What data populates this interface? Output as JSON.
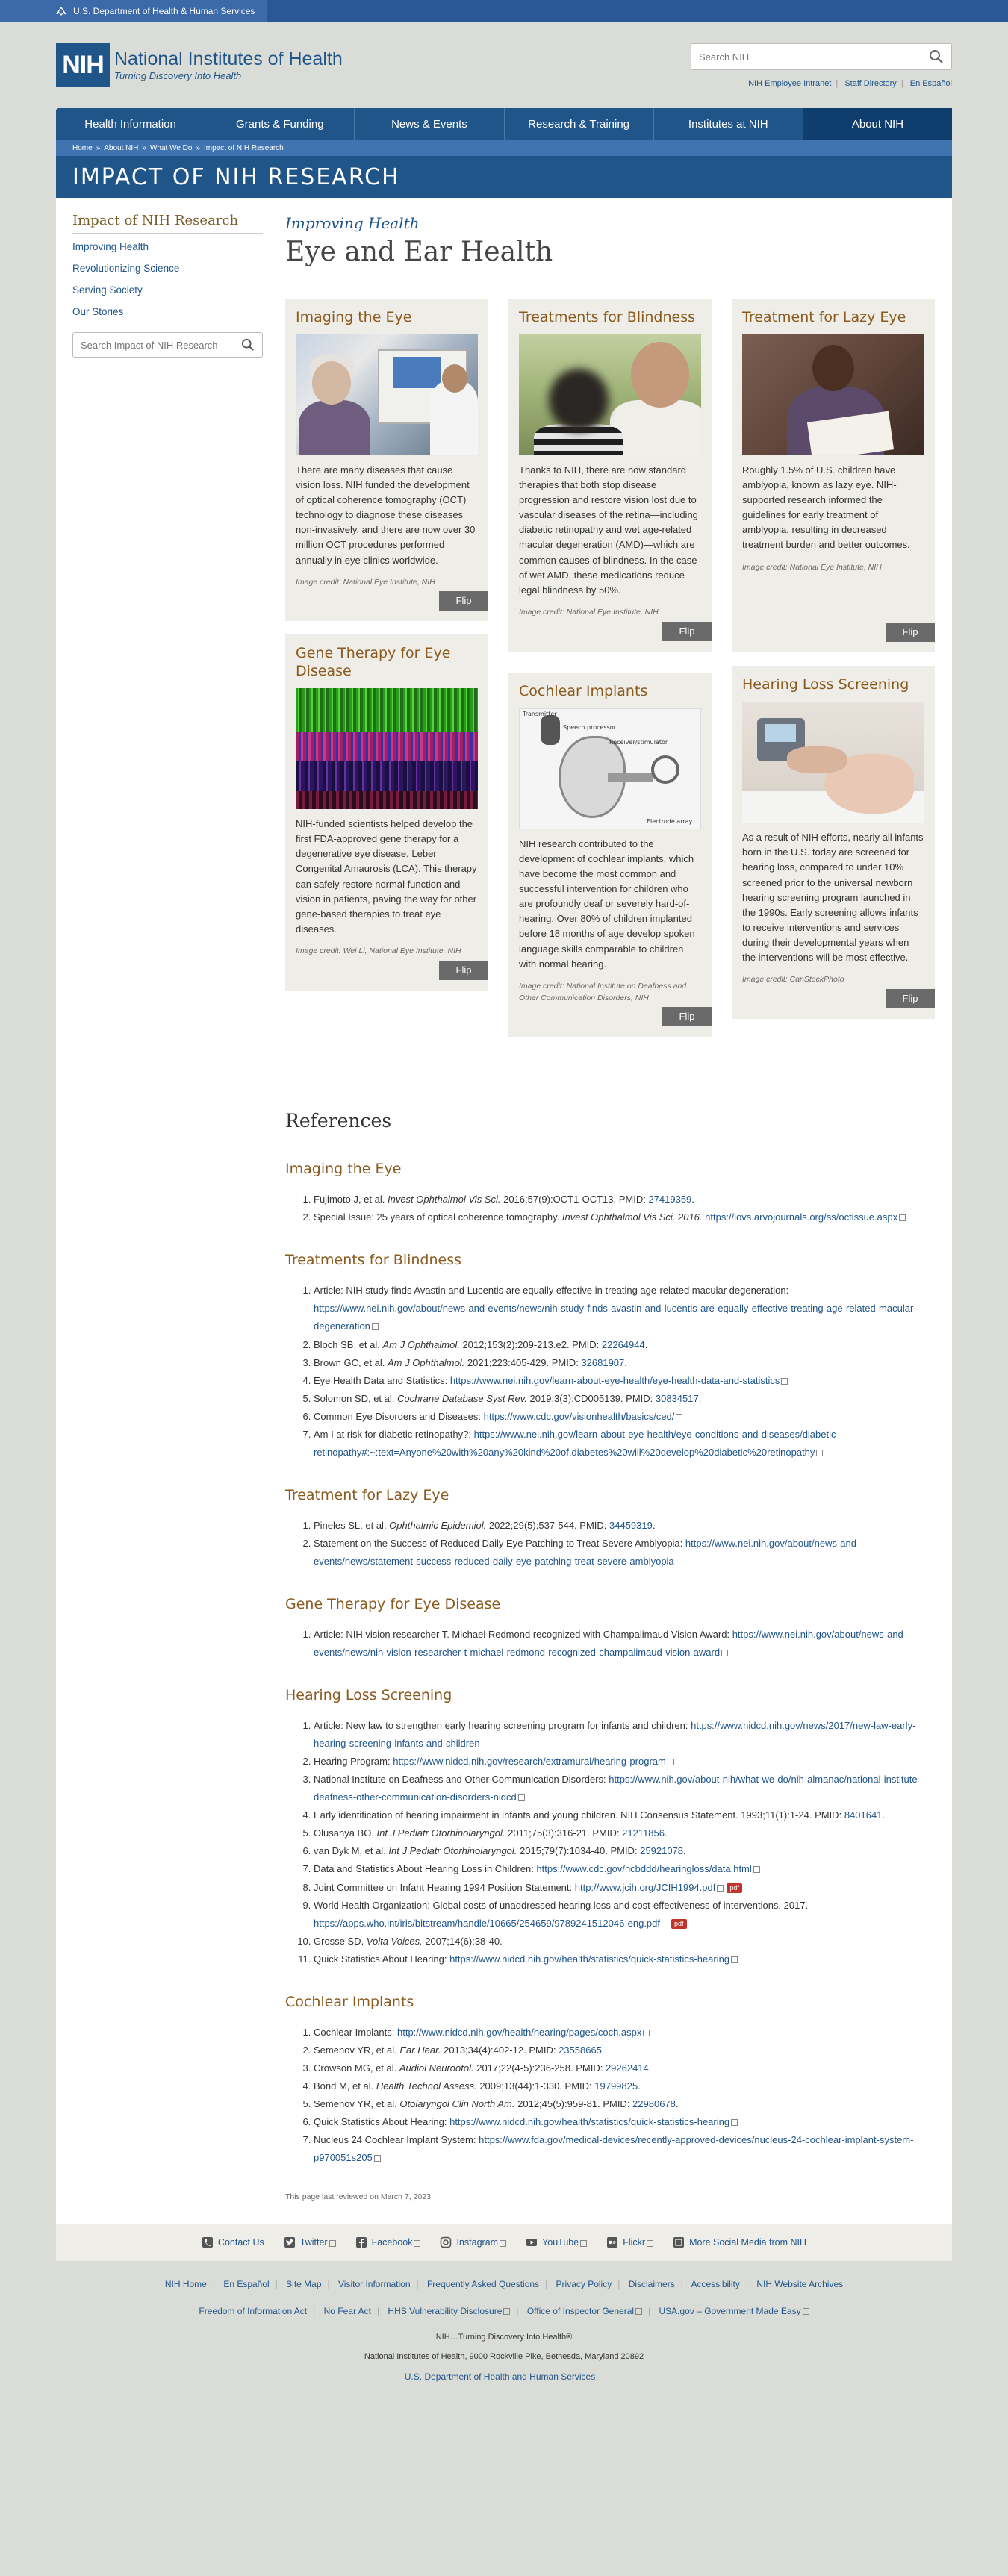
{
  "hhs": {
    "label": "U.S. Department of Health & Human Services"
  },
  "logo": {
    "mark": "NIH",
    "title": "National Institutes of Health",
    "tagline": "Turning Discovery Into Health"
  },
  "search": {
    "placeholder": "Search NIH"
  },
  "util_links": [
    "NIH Employee Intranet",
    "Staff Directory",
    "En Español"
  ],
  "nav": [
    "Health Information",
    "Grants & Funding",
    "News & Events",
    "Research & Training",
    "Institutes at NIH",
    "About NIH"
  ],
  "breadcrumb": [
    "Home",
    "About NIH",
    "What We Do",
    "Impact of NIH Research"
  ],
  "banner_title": "IMPACT OF NIH RESEARCH",
  "sidebar": {
    "title": "Impact of NIH Research",
    "links": [
      "Improving Health",
      "Revolutionizing Science",
      "Serving Society",
      "Our Stories"
    ],
    "search_placeholder": "Search Impact of NIH Research"
  },
  "page": {
    "kicker": "Improving Health",
    "title": "Eye and Ear Health"
  },
  "flip_label": "Flip",
  "cards": {
    "imaging": {
      "title": "Imaging the Eye",
      "body": "There are many diseases that cause vision loss. NIH funded the development of optical coherence tomography (OCT) technology to diagnose these diseases non-invasively, and there are now over 30 million OCT procedures performed annually in eye clinics worldwide.",
      "credit": "Image credit: National Eye Institute, NIH"
    },
    "blindness": {
      "title": "Treatments for Blindness",
      "body": "Thanks to NIH, there are now standard therapies that both stop disease progression and restore vision lost due to vascular diseases of the retina—including diabetic retinopathy and wet age-related macular degeneration (AMD)—which are common causes of blindness. In the case of wet AMD, these medications reduce legal blindness by 50%.",
      "credit": "Image credit: National Eye Institute, NIH"
    },
    "lazy": {
      "title": "Treatment for Lazy Eye",
      "body": "Roughly 1.5% of U.S. children have amblyopia, known as lazy eye. NIH-supported research informed the guidelines for early treatment of amblyopia, resulting in decreased treatment burden and better outcomes.",
      "credit": "Image credit: National Eye Institute, NIH"
    },
    "gene": {
      "title": "Gene Therapy for Eye Disease",
      "body": "NIH-funded scientists helped develop the first FDA-approved gene therapy for a degenerative eye disease, Leber Congenital Amaurosis (LCA). This therapy can safely restore normal function and vision in patients, paving the way for other gene-based therapies to treat eye diseases.",
      "credit": "Image credit: Wei Li, National Eye Institute, NIH"
    },
    "cochlear": {
      "title": "Cochlear Implants",
      "body": "NIH research contributed to the development of cochlear implants, which have become the most common and successful intervention for children who are profoundly deaf or severely hard-of-hearing. Over 80% of children implanted before 18 months of age develop spoken language skills comparable to children with normal hearing.",
      "credit": "Image credit: National Institute on Deafness and Other Communication Disorders, NIH",
      "diagram_labels": {
        "transmitter": "Transmitter",
        "speech": "Speech processor",
        "receiver": "Receiver/stimulator",
        "electrode": "Electrode array"
      }
    },
    "hearing": {
      "title": "Hearing Loss Screening",
      "body": "As a result of NIH efforts, nearly all infants born in the U.S. today are screened for hearing loss, compared to under 10% screened prior to the universal newborn hearing screening program launched in the 1990s. Early screening allows infants to receive interventions and services during their developmental years when the interventions will be most effective.",
      "credit": "Image credit: CanStockPhoto"
    }
  },
  "references": {
    "heading": "References",
    "imaging": {
      "heading": "Imaging the Eye",
      "items": [
        {
          "pre": "Fujimoto J, et al. ",
          "journal": "Invest Ophthalmol Vis Sci.",
          "post": " 2016;57(9):OCT1-OCT13. PMID: ",
          "link": "27419359",
          "tail": "."
        },
        {
          "pre": "Special Issue: 25 years of optical coherence tomography. ",
          "journal": "Invest Ophthalmol Vis Sci. 2016.",
          "post": " ",
          "link": "https://iovs.arvojournals.org/ss/octissue.aspx",
          "tail": ""
        }
      ]
    },
    "blindness": {
      "heading": "Treatments for Blindness",
      "items": [
        {
          "pre": "Article: NIH study finds Avastin and Lucentis are equally effective in treating age-related macular degeneration: ",
          "journal": "",
          "post": "",
          "link": "https://www.nei.nih.gov/about/news-and-events/news/nih-study-finds-avastin-and-lucentis-are-equally-effective-treating-age-related-macular-degeneration",
          "tail": ""
        },
        {
          "pre": "Bloch SB, et al. ",
          "journal": "Am J Ophthalmol.",
          "post": " 2012;153(2):209-213.e2. PMID: ",
          "link": "22264944",
          "tail": "."
        },
        {
          "pre": "Brown GC, et al. ",
          "journal": "Am J Ophthalmol.",
          "post": " 2021;223:405-429. PMID: ",
          "link": "32681907",
          "tail": "."
        },
        {
          "pre": "Eye Health Data and Statistics: ",
          "journal": "",
          "post": "",
          "link": "https://www.nei.nih.gov/learn-about-eye-health/eye-health-data-and-statistics",
          "tail": ""
        },
        {
          "pre": "Solomon SD, et al. ",
          "journal": "Cochrane Database Syst Rev.",
          "post": " 2019;3(3):CD005139. PMID: ",
          "link": "30834517",
          "tail": "."
        },
        {
          "pre": "Common Eye Disorders and Diseases: ",
          "journal": "",
          "post": "",
          "link": "https://www.cdc.gov/visionhealth/basics/ced/",
          "tail": ""
        },
        {
          "pre": "Am I at risk for diabetic retinopathy?: ",
          "journal": "",
          "post": "",
          "link": "https://www.nei.nih.gov/learn-about-eye-health/eye-conditions-and-diseases/diabetic-retinopathy#:~:text=Anyone%20with%20any%20kind%20of,diabetes%20will%20develop%20diabetic%20retinopathy",
          "tail": ""
        }
      ]
    },
    "lazy": {
      "heading": "Treatment for Lazy Eye",
      "items": [
        {
          "pre": "Pineles SL, et al. ",
          "journal": "Ophthalmic Epidemiol.",
          "post": " 2022;29(5):537-544. PMID: ",
          "link": "34459319",
          "tail": "."
        },
        {
          "pre": "Statement on the Success of Reduced Daily Eye Patching to Treat Severe Amblyopia: ",
          "journal": "",
          "post": "",
          "link": "https://www.nei.nih.gov/about/news-and-events/news/statement-success-reduced-daily-eye-patching-treat-severe-amblyopia",
          "tail": ""
        }
      ]
    },
    "gene": {
      "heading": "Gene Therapy for Eye Disease",
      "items": [
        {
          "pre": "Article: NIH vision researcher T. Michael Redmond recognized with Champalimaud Vision Award: ",
          "journal": "",
          "post": "",
          "link": "https://www.nei.nih.gov/about/news-and-events/news/nih-vision-researcher-t-michael-redmond-recognized-champalimaud-vision-award",
          "tail": ""
        }
      ]
    },
    "hearing": {
      "heading": "Hearing Loss Screening",
      "items": [
        {
          "pre": "Article: New law to strengthen early hearing screening program for infants and children: ",
          "journal": "",
          "post": "",
          "link": "https://www.nidcd.nih.gov/news/2017/new-law-early-hearing-screening-infants-and-children",
          "tail": ""
        },
        {
          "pre": "Hearing Program: ",
          "journal": "",
          "post": "",
          "link": "https://www.nidcd.nih.gov/research/extramural/hearing-program",
          "tail": ""
        },
        {
          "pre": "National Institute on Deafness and Other Communication Disorders: ",
          "journal": "",
          "post": "",
          "link": "https://www.nih.gov/about-nih/what-we-do/nih-almanac/national-institute-deafness-other-communication-disorders-nidcd",
          "tail": ""
        },
        {
          "pre": "Early identification of hearing impairment in infants and young children. NIH Consensus Statement. 1993;11(1):1-24. PMID: ",
          "journal": "",
          "post": "",
          "link": "8401641",
          "tail": "."
        },
        {
          "pre": "Olusanya BO. ",
          "journal": "Int J Pediatr Otorhinolaryngol.",
          "post": " 2011;75(3):316-21. PMID: ",
          "link": "21211856",
          "tail": "."
        },
        {
          "pre": "van Dyk M, et al. ",
          "journal": "Int J Pediatr Otorhinolaryngol.",
          "post": " 2015;79(7):1034-40. PMID: ",
          "link": "25921078",
          "tail": "."
        },
        {
          "pre": "Data and Statistics About Hearing Loss in Children: ",
          "journal": "",
          "post": "",
          "link": "https://www.cdc.gov/ncbddd/hearingloss/data.html",
          "tail": ""
        },
        {
          "pre": "Joint Committee on Infant Hearing 1994 Position Statement: ",
          "journal": "",
          "post": "",
          "link": "http://www.jcih.org/JCIH1994.pdf",
          "tail": "",
          "pdf": true
        },
        {
          "pre": "World Health Organization: Global costs of unaddressed hearing loss and cost-effectiveness of interventions. 2017. ",
          "journal": "",
          "post": "",
          "link": "https://apps.who.int/iris/bitstream/handle/10665/254659/9789241512046-eng.pdf",
          "tail": "",
          "pdf": true
        },
        {
          "pre": "Grosse SD. ",
          "journal": "Volta Voices.",
          "post": " 2007;14(6):38-40.",
          "link": "",
          "tail": ""
        },
        {
          "pre": "Quick Statistics About Hearing: ",
          "journal": "",
          "post": "",
          "link": "https://www.nidcd.nih.gov/health/statistics/quick-statistics-hearing",
          "tail": ""
        }
      ]
    },
    "cochlear": {
      "heading": "Cochlear Implants",
      "items": [
        {
          "pre": "Cochlear Implants: ",
          "journal": "",
          "post": "",
          "link": "http://www.nidcd.nih.gov/health/hearing/pages/coch.aspx",
          "tail": ""
        },
        {
          "pre": "Semenov YR, et al. ",
          "journal": "Ear Hear.",
          "post": " 2013;34(4):402-12. PMID: ",
          "link": "23558665",
          "tail": "."
        },
        {
          "pre": "Crowson MG, et al. ",
          "journal": "Audiol Neurootol.",
          "post": " 2017;22(4-5):236-258. PMID: ",
          "link": "29262414",
          "tail": "."
        },
        {
          "pre": "Bond M, et al. ",
          "journal": "Health Technol Assess.",
          "post": " 2009;13(44):1-330. PMID: ",
          "link": "19799825",
          "tail": "."
        },
        {
          "pre": "Semenov YR, et al. ",
          "journal": "Otolaryngol Clin North Am.",
          "post": " 2012;45(5):959-81. PMID: ",
          "link": "22980678",
          "tail": "."
        },
        {
          "pre": "Quick Statistics About Hearing: ",
          "journal": "",
          "post": "",
          "link": "https://www.nidcd.nih.gov/health/statistics/quick-statistics-hearing",
          "tail": ""
        },
        {
          "pre": "Nucleus 24 Cochlear Implant System: ",
          "journal": "",
          "post": "",
          "link": "https://www.fda.gov/medical-devices/recently-approved-devices/nucleus-24-cochlear-implant-system-p970051s205",
          "tail": ""
        }
      ]
    }
  },
  "reviewed": "This page last reviewed on March 7, 2023",
  "social": [
    "Contact Us",
    "Twitter",
    "Facebook",
    "Instagram",
    "YouTube",
    "Flickr",
    "More Social Media from NIH"
  ],
  "footer": {
    "row1": [
      "NIH Home",
      "En Español",
      "Site Map",
      "Visitor Information",
      "Frequently Asked Questions",
      "Privacy Policy",
      "Disclaimers",
      "Accessibility",
      "NIH Website Archives"
    ],
    "row2": [
      "Freedom of Information Act",
      "No Fear Act",
      "HHS Vulnerability Disclosure",
      "Office of Inspector General",
      "USA.gov – Government Made Easy"
    ],
    "tagline": "NIH…Turning Discovery Into Health®",
    "address": "National Institutes of Health, 9000 Rockville Pike, Bethesda, Maryland 20892",
    "hhs": "U.S. Department of Health and Human Services"
  }
}
